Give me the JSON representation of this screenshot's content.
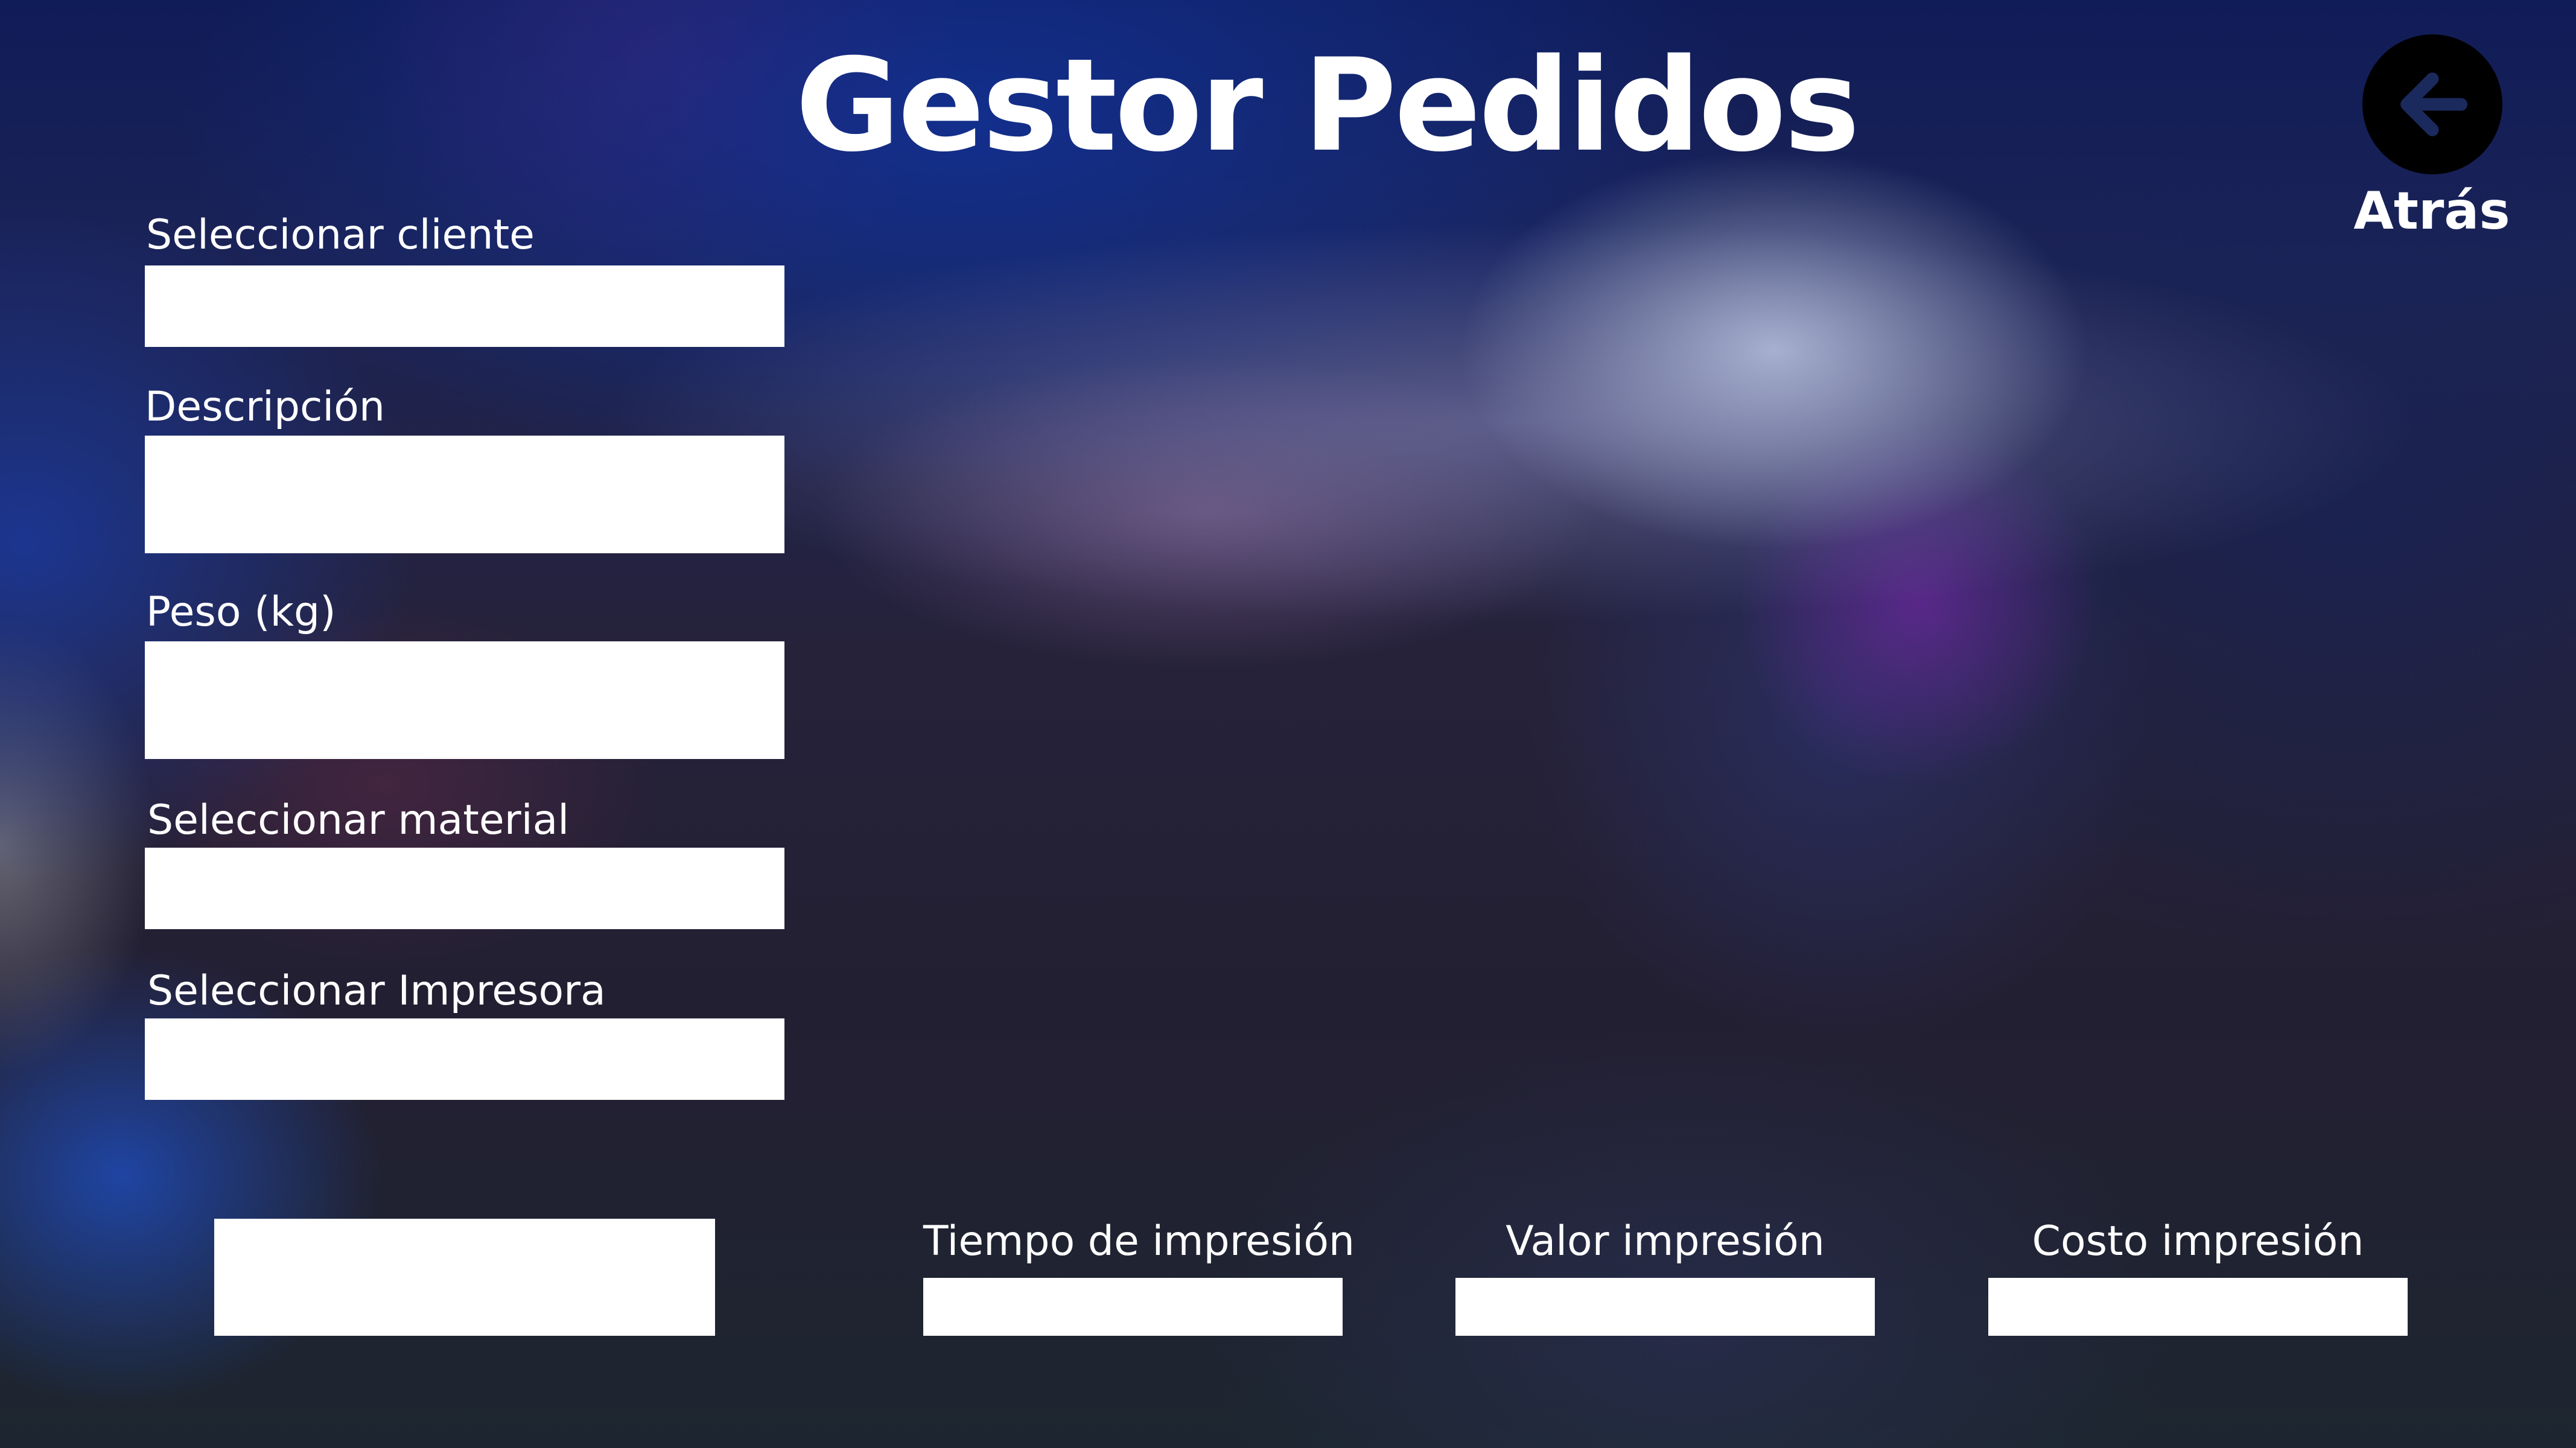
{
  "app": {
    "title": "Gestor Pedidos"
  },
  "header": {
    "back_label": "Atrás",
    "back_icon": "arrow-left-icon"
  },
  "form": {
    "client": {
      "label": "Seleccionar cliente",
      "value": ""
    },
    "description": {
      "label": "Descripción",
      "value": ""
    },
    "weight": {
      "label": "Peso (kg)",
      "value": ""
    },
    "material": {
      "label": "Seleccionar material",
      "value": ""
    },
    "printer": {
      "label": "Seleccionar Impresora",
      "value": ""
    }
  },
  "results": {
    "print_time": {
      "label": "Tiempo de impresión",
      "value": ""
    },
    "print_value": {
      "label": "Valor impresión",
      "value": ""
    },
    "print_cost": {
      "label": "Costo impresión",
      "value": ""
    }
  },
  "actions": {
    "primary_label": ""
  },
  "colors": {
    "text": "#ffffff",
    "field_background": "#ffffff",
    "back_button_background": "#000000",
    "back_arrow": "#1b2a5c"
  }
}
